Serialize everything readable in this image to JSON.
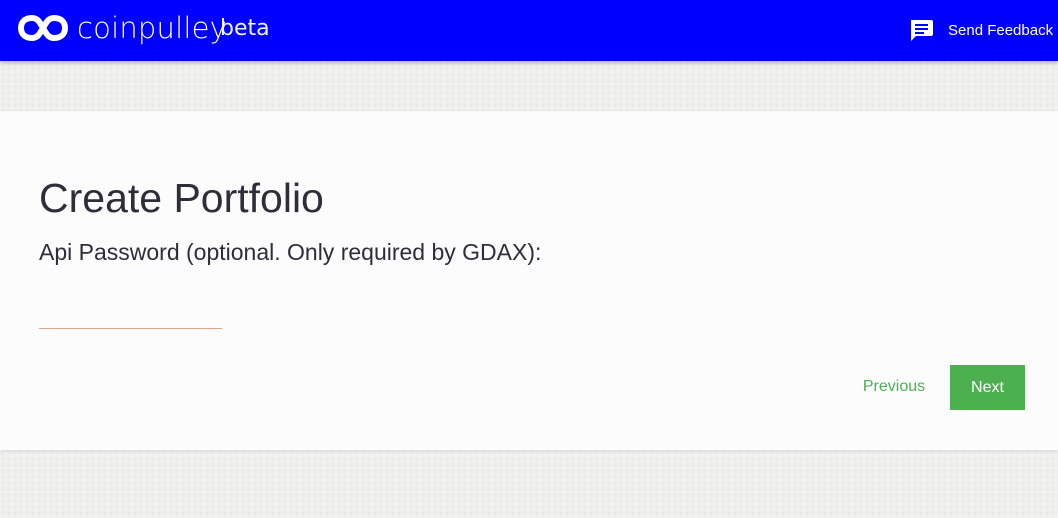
{
  "header": {
    "brand_name": "coinpulley",
    "brand_tag": "beta",
    "logo_icon": "infinity-icon",
    "feedback_icon": "feedback-message-icon",
    "feedback_label": "Send Feedback",
    "bar_color": "#0000ff"
  },
  "form": {
    "title": "Create Portfolio",
    "field_label": "Api Password (optional. Only required by GDAX):",
    "field_value": "",
    "underline_color": "#e0a48c"
  },
  "actions": {
    "previous_label": "Previous",
    "next_label": "Next",
    "accent_color": "#4caf50"
  }
}
